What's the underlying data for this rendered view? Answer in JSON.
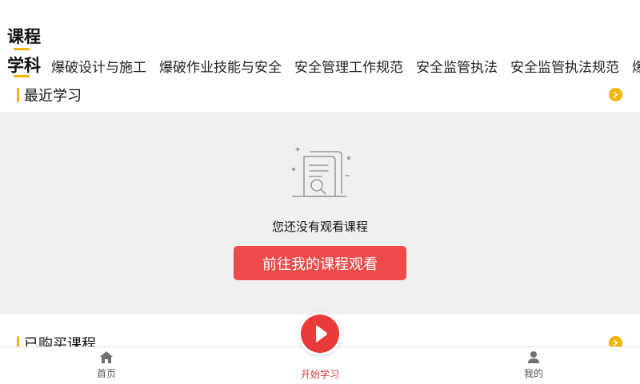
{
  "header": {
    "title": "课程"
  },
  "subjects": {
    "label": "学科",
    "tabs": [
      "爆破设计与施工",
      "爆破作业技能与安全",
      "安全管理工作规范",
      "安全监管执法",
      "安全监管执法规范",
      "爆破"
    ]
  },
  "recent": {
    "title": "最近学习",
    "empty_text": "您还没有观看课程",
    "cta_label": "前往我的课程观看"
  },
  "purchased": {
    "title": "已购买课程"
  },
  "bottom_nav": {
    "home_label": "首页",
    "start_label": "开始学习",
    "mine_label": "我的"
  },
  "colors": {
    "accent": "#f2b500",
    "primary": "#ef4a4a",
    "panel": "#f0f0f0"
  },
  "icons": [
    "chevron-right-icon",
    "empty-document-icon",
    "home-icon",
    "play-icon",
    "user-icon"
  ]
}
